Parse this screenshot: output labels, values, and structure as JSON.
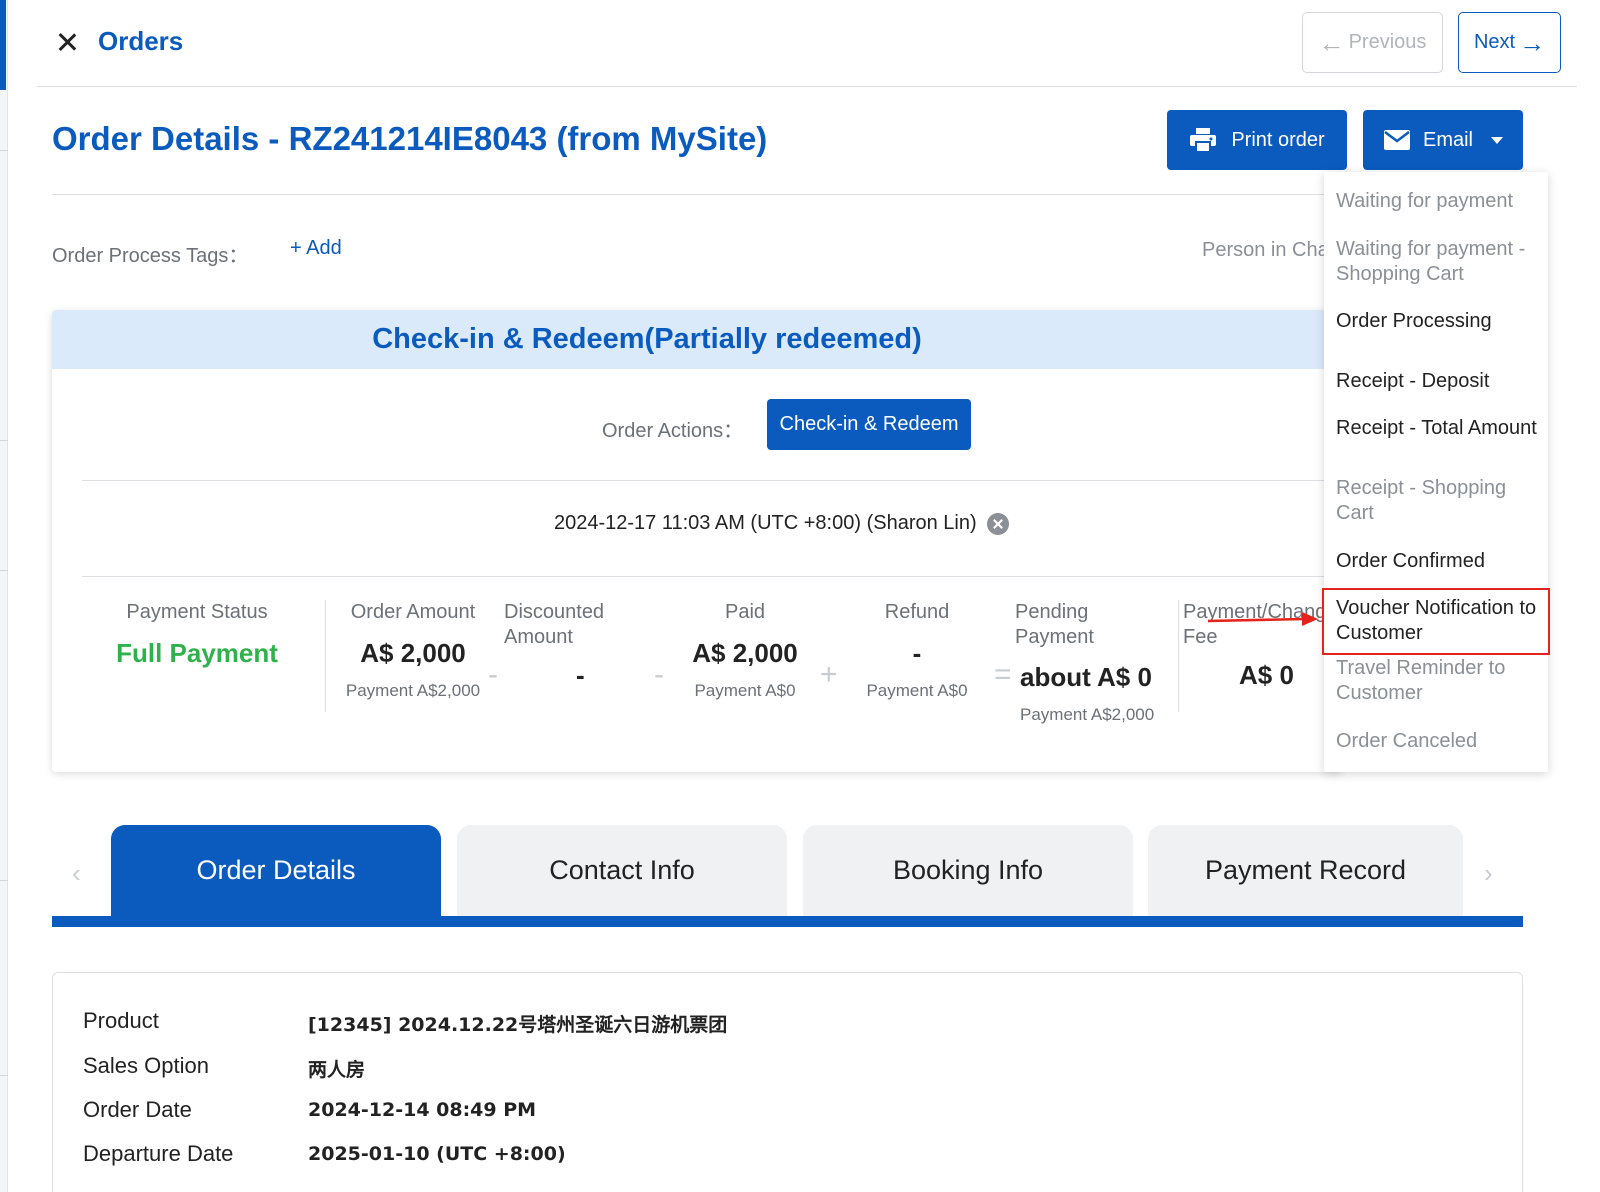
{
  "topbar": {
    "title": "Orders",
    "previous_label": "Previous",
    "next_label": "Next"
  },
  "header": {
    "title": "Order Details  - RZ241214IE8043 (from MySite)",
    "print_label": "Print order",
    "email_label": "Email"
  },
  "tags": {
    "label": "Order Process Tags：",
    "add_label": "+ Add",
    "person_label": "Person in Charge"
  },
  "status": {
    "banner": "Check-in & Redeem(Partially redeemed)",
    "actions_label": "Order Actions：",
    "checkin_label": "Check-in & Redeem",
    "redeem_record": "2024-12-17 11:03 AM (UTC +8:00) (Sharon Lin)"
  },
  "summary": {
    "payment_status_label": "Payment Status",
    "payment_status_value": "Full Payment",
    "order_amount_label": "Order Amount",
    "order_amount_value": "A$ 2,000",
    "order_amount_sub": "Payment A$2,000",
    "discounted_label_1": "Discounted",
    "discounted_label_2": "Amount",
    "discounted_value": "-",
    "paid_label": "Paid",
    "paid_value": "A$ 2,000",
    "paid_sub": "Payment A$0",
    "refund_label": "Refund",
    "refund_value": "-",
    "refund_sub": "Payment A$0",
    "pending_label_1": "Pending",
    "pending_label_2": "Payment",
    "pending_value": "about A$ 0",
    "pending_sub": "Payment A$2,000",
    "fee_label_1": "Payment/Change",
    "fee_label_2": "Fee",
    "fee_value": "A$ 0",
    "op_minus": "-",
    "op_plus": "+",
    "op_equals": "="
  },
  "email_menu": {
    "items": [
      {
        "label": "Waiting for payment",
        "enabled": false
      },
      {
        "label": "Waiting for payment - Shopping Cart",
        "enabled": false
      },
      {
        "label": "Order Processing",
        "enabled": true
      },
      {
        "label": "Receipt - Deposit",
        "enabled": true
      },
      {
        "label": "Receipt - Total Amount",
        "enabled": true
      },
      {
        "label": "Receipt - Shopping Cart",
        "enabled": false
      },
      {
        "label": "Order Confirmed",
        "enabled": true
      },
      {
        "label": "Voucher Notification to Customer",
        "enabled": true
      },
      {
        "label": "Travel Reminder to Customer",
        "enabled": false
      },
      {
        "label": "Order Canceled",
        "enabled": false
      }
    ]
  },
  "tabs": [
    {
      "label": "Order Details",
      "active": true
    },
    {
      "label": "Contact Info",
      "active": false
    },
    {
      "label": "Booking Info",
      "active": false
    },
    {
      "label": "Payment Record",
      "active": false
    }
  ],
  "details": {
    "rows": [
      {
        "key": "Product",
        "value": "[12345] 2024.12.22号塔州圣诞六日游机票团"
      },
      {
        "key": "Sales Option",
        "value": "两人房"
      },
      {
        "key": "Order Date",
        "value": "2024-12-14 08:49 PM"
      },
      {
        "key": "Departure Date",
        "value": "2025-01-10 (UTC +8:00)"
      }
    ]
  },
  "icons": {
    "close": "close-icon",
    "prev_arrow": "arrow-left-icon",
    "next_arrow": "arrow-right-icon",
    "printer": "printer-icon",
    "mail": "mail-icon",
    "clear": "x-circle-icon"
  },
  "colors": {
    "primary": "#0a5bbd",
    "success": "#2fb24c",
    "highlight": "#e3231c",
    "banner_bg": "#dbeafb"
  }
}
